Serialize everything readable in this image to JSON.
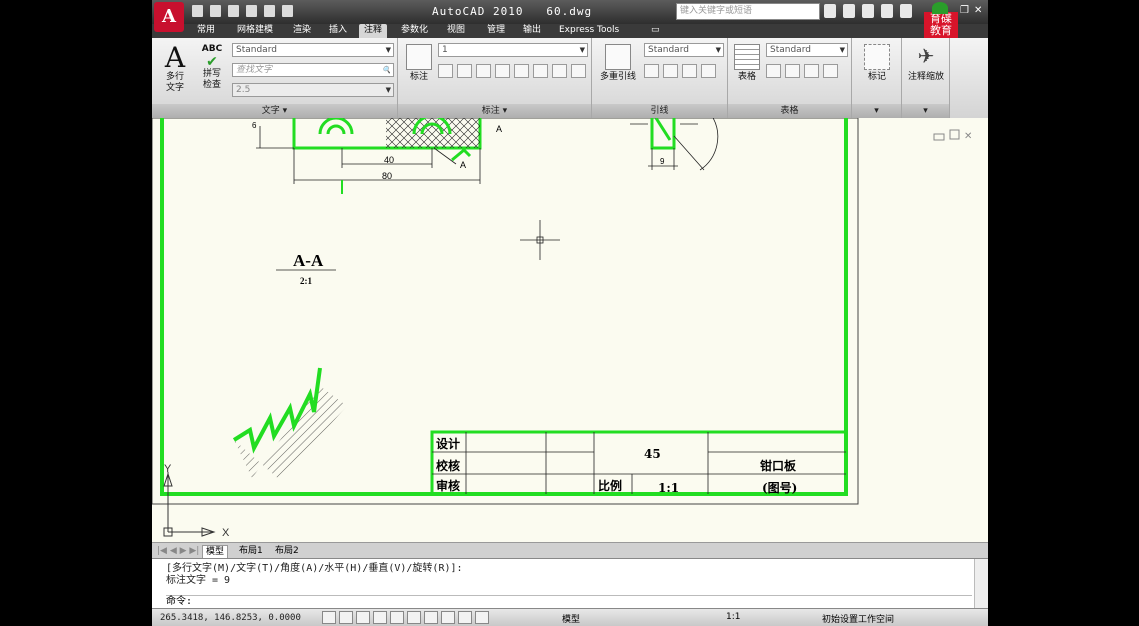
{
  "title": {
    "app": "AutoCAD 2010",
    "file": "60.dwg",
    "search_placeholder": "键入关键字或短语",
    "brand": "育碟\n教育"
  },
  "tabs": [
    "常用",
    "网格建模",
    "渲染",
    "插入",
    "注释",
    "参数化",
    "视图",
    "管理",
    "输出",
    "Express Tools"
  ],
  "active_tab": "注释",
  "ribbon": {
    "text_panel": {
      "mtext": "多行\n文字",
      "mtext_arrow": "▾",
      "spell": "拼写\n检查",
      "abc": "ABC",
      "style": "Standard",
      "find": "查找文字",
      "height": "2.5",
      "footer": "文字 ▾"
    },
    "dim_panel": {
      "label": "标注",
      "combo": "1",
      "footer": "标注 ▾"
    },
    "leader_panel": {
      "label": "多重引线",
      "style": "Standard",
      "footer": "引线"
    },
    "table_panel": {
      "label": "表格",
      "style": "Standard",
      "footer": "表格"
    },
    "mark_panel": {
      "label": "标记",
      "footer": "▾"
    },
    "scale_panel": {
      "label": "注释缩放",
      "footer": "▾"
    }
  },
  "drawing": {
    "dim_40": "40",
    "dim_80": "80",
    "label_a1": "A",
    "label_a2": "A",
    "dim_9": "9",
    "dim_6": "6",
    "section_title": "A-A",
    "section_scale": "2:1",
    "title_block": {
      "design": "设计",
      "check": "校核",
      "approve": "审核",
      "material": "45",
      "ratio_label": "比例",
      "ratio": "1:1",
      "part_name": "钳口板",
      "drawing_no": "(图号)"
    },
    "axis_y": "Y",
    "axis_x": "X"
  },
  "layout_tabs": [
    "模型",
    "布局1",
    "布局2"
  ],
  "command": {
    "line1": "[多行文字(M)/文字(T)/角度(A)/水平(H)/垂直(V)/旋转(R)]:",
    "line2": "标注文字 = 9",
    "prompt": "命令:"
  },
  "status": {
    "coords": "265.3418, 146.8253, 0.0000",
    "model": "模型",
    "scale": "1:1",
    "workspace": "初始设置工作空间"
  }
}
